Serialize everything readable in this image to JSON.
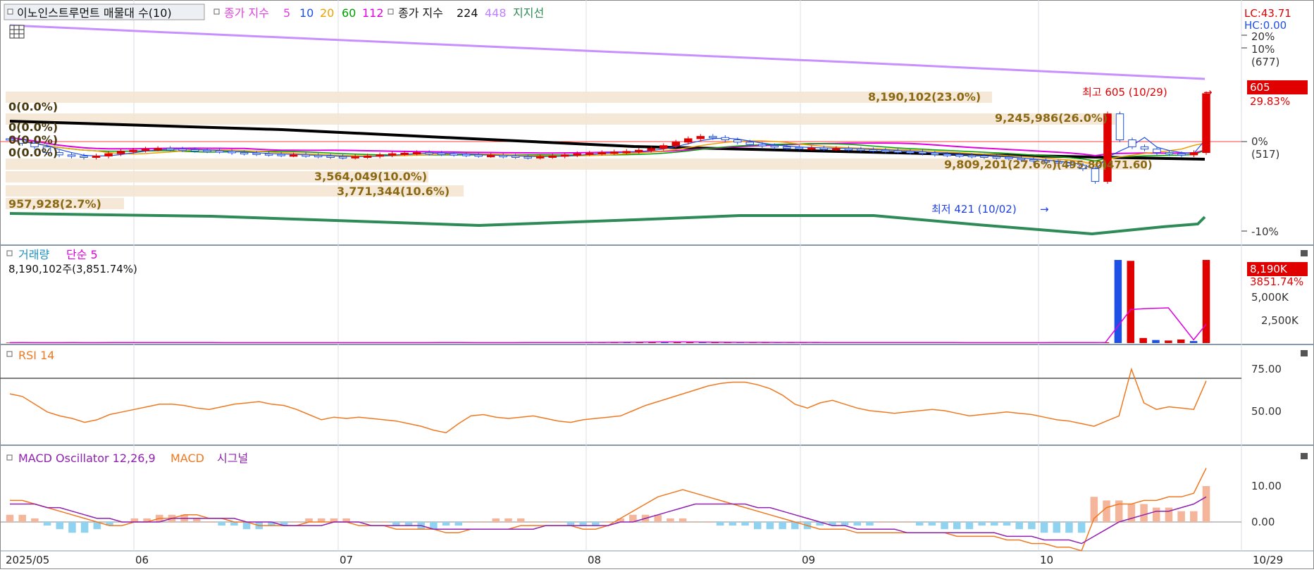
{
  "chart_data": [
    {
      "type": "candlestick",
      "legend": {
        "main_title": "이노인스트루먼트 매물대 수(10)",
        "ma_label": "종가 지수",
        "ma_periods": [
          "5",
          "10",
          "20",
          "60",
          "112"
        ],
        "ma_colors": [
          "#e040e0",
          "#1e50e6",
          "#f0a000",
          "#00a000",
          "#e000e0"
        ],
        "ma2_label": "종가 지수",
        "ma2_periods": [
          "224",
          "448"
        ],
        "ma2_colors": [
          "#000000",
          "#c080ff"
        ],
        "support_label": "지지선"
      },
      "right_axis": {
        "lc": "LC:43.71",
        "hc": "HC:0.00",
        "ticks": [
          "20%",
          "10%",
          "(677)",
          "0%",
          "(517)",
          "-10%"
        ],
        "price_badge": "605",
        "change_pct": "29.83%"
      },
      "x_dates": [
        "2025/05",
        "06",
        "07",
        "08",
        "09",
        "10"
      ],
      "x_last_label": "10/29",
      "annotations": {
        "high": "최고 605 (10/29)",
        "low": "최저 421 (10/02)"
      },
      "volume_profile": [
        {
          "label": "8,190,102(23.0%)"
        },
        {
          "label": "9,245,986(26.0%)"
        },
        {
          "label": "9,809,201(27.6%)"
        },
        {
          "label": "3,564,049(10.0%)"
        },
        {
          "label": "3,771,344(10.6%)"
        },
        {
          "label": "957,928(2.7%)"
        },
        {
          "label": "0(0.0%)"
        },
        {
          "label": "0(0.0%)"
        },
        {
          "label": "0(0.0%)"
        },
        {
          "label": "0(0.0%)"
        }
      ],
      "price_labels_right": [
        "(495.80)",
        "(471.60)"
      ],
      "candles_close": [
        520,
        514,
        508,
        498,
        494,
        492,
        490,
        492,
        496,
        500,
        502,
        504,
        505,
        504,
        503,
        502,
        501,
        500,
        498,
        497,
        496,
        495,
        494,
        494,
        493,
        492,
        491,
        490,
        491,
        492,
        494,
        496,
        497,
        498,
        497,
        496,
        495,
        494,
        493,
        493,
        492,
        491,
        490,
        491,
        492,
        494,
        496,
        497,
        498,
        499,
        500,
        502,
        505,
        510,
        516,
        522,
        526,
        524,
        520,
        516,
        512,
        510,
        508,
        507,
        506,
        506,
        505,
        505,
        504,
        503,
        502,
        501,
        500,
        499,
        497,
        495,
        494,
        493,
        492,
        491,
        490,
        488,
        486,
        484,
        482,
        480,
        476,
        470,
        448,
        565,
        520,
        508,
        504,
        498,
        496,
        494,
        498,
        600
      ],
      "volume_spike_series": [
        {
          "name": "거래량"
        },
        {
          "name": "단순 5"
        }
      ]
    },
    {
      "type": "bar",
      "title": "거래량",
      "ma_label": "단순 5",
      "readout": "8,190,102주(3,851.74%)",
      "ticks": [
        "5,000K",
        "2,500K"
      ],
      "badge": "8,190K",
      "badge_pct": "3851.74%",
      "values_k": [
        45,
        50,
        40,
        42,
        48,
        46,
        44,
        43,
        50,
        45,
        44,
        46,
        48,
        47,
        45,
        44,
        42,
        40,
        42,
        45,
        43,
        41,
        40,
        44,
        42,
        45,
        47,
        43,
        41,
        42,
        44,
        46,
        48,
        45,
        44,
        43,
        46,
        42,
        40,
        44,
        48,
        52,
        55,
        58,
        60,
        62,
        65,
        70,
        80,
        95,
        120,
        140,
        110,
        90,
        80,
        75,
        70,
        68,
        66,
        65,
        64,
        62,
        60,
        58,
        57,
        56,
        55,
        54,
        53,
        52,
        50,
        48,
        47,
        46,
        45,
        44,
        43,
        42,
        41,
        40,
        42,
        45,
        50,
        55,
        60,
        62,
        65,
        70,
        8190,
        8100,
        500,
        300,
        250,
        350,
        200,
        8190
      ],
      "colors": [
        "up",
        "down"
      ]
    },
    {
      "type": "line",
      "title": "RSI 14",
      "ticks": [
        "75.00",
        "50.00"
      ],
      "values": [
        63,
        61,
        55,
        49,
        46,
        44,
        41,
        43,
        47,
        49,
        51,
        53,
        55,
        55,
        54,
        52,
        51,
        53,
        55,
        56,
        57,
        55,
        54,
        51,
        47,
        43,
        45,
        44,
        45,
        44,
        43,
        42,
        40,
        38,
        35,
        33,
        40,
        46,
        47,
        45,
        44,
        45,
        46,
        44,
        42,
        41,
        43,
        44,
        45,
        46,
        50,
        54,
        57,
        60,
        63,
        66,
        69,
        71,
        72,
        72,
        70,
        67,
        62,
        55,
        52,
        56,
        58,
        55,
        52,
        50,
        49,
        48,
        49,
        50,
        51,
        50,
        48,
        46,
        47,
        48,
        49,
        48,
        47,
        45,
        43,
        42,
        40,
        38,
        42,
        46,
        82,
        56,
        51,
        53,
        52,
        51,
        73
      ]
    },
    {
      "type": "line_bar",
      "title": "MACD Oscillator 12,26,9",
      "series_names": [
        "MACD",
        "시그널"
      ],
      "ticks": [
        "10.00",
        "0.00"
      ],
      "osc": [
        2,
        2,
        1,
        -1,
        -2,
        -3,
        -3,
        -2,
        -1,
        0,
        1,
        1,
        2,
        2,
        2,
        1,
        0,
        -1,
        -1,
        -2,
        -2,
        -1,
        -1,
        0,
        1,
        1,
        1,
        1,
        0,
        0,
        0,
        -1,
        -1,
        -2,
        -2,
        -1,
        -1,
        0,
        0,
        1,
        1,
        1,
        0,
        0,
        0,
        -1,
        -1,
        -1,
        0,
        1,
        2,
        2,
        2,
        1,
        1,
        0,
        0,
        -1,
        -1,
        -1,
        -2,
        -2,
        -2,
        -2,
        -2,
        -1,
        -1,
        -1,
        -1,
        -1,
        0,
        0,
        0,
        -1,
        -1,
        -2,
        -2,
        -2,
        -1,
        -1,
        -1,
        -2,
        -2,
        -3,
        -3,
        -3,
        -3,
        7,
        6,
        6,
        5,
        5,
        4,
        4,
        3,
        3,
        10
      ],
      "macd": [
        6,
        6,
        5,
        4,
        3,
        2,
        1,
        0,
        -1,
        -1,
        0,
        0,
        1,
        1,
        2,
        2,
        1,
        1,
        0,
        0,
        -1,
        -1,
        -1,
        -1,
        0,
        0,
        0,
        0,
        -1,
        -1,
        -1,
        -2,
        -2,
        -2,
        -2,
        -3,
        -3,
        -2,
        -2,
        -2,
        -2,
        -1,
        -1,
        -1,
        -1,
        -1,
        -2,
        -2,
        -1,
        1,
        3,
        5,
        7,
        8,
        9,
        8,
        7,
        6,
        5,
        4,
        3,
        2,
        1,
        0,
        -1,
        -2,
        -2,
        -2,
        -3,
        -3,
        -3,
        -3,
        -3,
        -3,
        -3,
        -3,
        -4,
        -4,
        -4,
        -4,
        -5,
        -5,
        -6,
        -6,
        -7,
        -7,
        -8,
        1,
        4,
        5,
        5,
        6,
        6,
        7,
        7,
        8,
        15
      ],
      "signal": [
        5,
        5,
        5,
        4,
        4,
        3,
        2,
        1,
        1,
        0,
        0,
        0,
        0,
        1,
        1,
        1,
        1,
        1,
        1,
        0,
        0,
        0,
        -1,
        -1,
        -1,
        -1,
        0,
        0,
        0,
        -1,
        -1,
        -1,
        -1,
        -1,
        -2,
        -2,
        -2,
        -2,
        -2,
        -2,
        -2,
        -2,
        -2,
        -1,
        -1,
        -1,
        -1,
        -1,
        -1,
        0,
        0,
        1,
        2,
        3,
        4,
        5,
        5,
        5,
        5,
        5,
        4,
        4,
        3,
        2,
        1,
        0,
        -1,
        -1,
        -2,
        -2,
        -2,
        -2,
        -3,
        -3,
        -3,
        -3,
        -3,
        -3,
        -3,
        -3,
        -4,
        -4,
        -4,
        -5,
        -5,
        -5,
        -6,
        -4,
        -2,
        0,
        1,
        2,
        3,
        3,
        4,
        5,
        7
      ]
    }
  ]
}
